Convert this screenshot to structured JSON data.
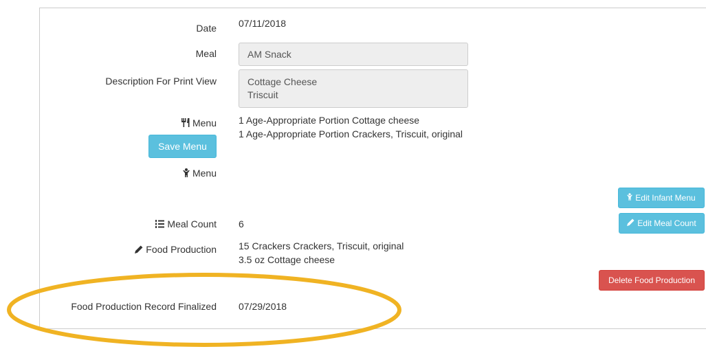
{
  "form": {
    "date_label": "Date",
    "date_value": "07/11/2018",
    "meal_label": "Meal",
    "meal_value": "AM Snack",
    "description_label": "Description For Print View",
    "description_lines": [
      "Cottage Cheese",
      "Triscuit"
    ],
    "menu_label": "Menu",
    "menu_items": [
      "1 Age-Appropriate Portion Cottage cheese",
      "1 Age-Appropriate Portion Crackers, Triscuit, original"
    ],
    "save_menu_label": "Save Menu",
    "infant_menu_label": "Menu",
    "edit_infant_menu_label": "Edit Infant Menu",
    "meal_count_label": "Meal Count",
    "meal_count_value": "6",
    "edit_meal_count_label": "Edit Meal Count",
    "food_production_label": "Food Production",
    "food_production_items": [
      "15 Crackers Crackers, Triscuit, original",
      "3.5 oz Cottage cheese"
    ],
    "delete_food_production_label": "Delete Food Production",
    "finalized_label": "Food Production Record Finalized",
    "finalized_value": "07/29/2018"
  },
  "icons": {
    "menu": "fork-knife-icon",
    "infant_menu": "child-icon",
    "meal_count": "list-ordered-icon",
    "food_production": "pencil-icon"
  },
  "colors": {
    "info_button": "#5bc0de",
    "danger_button": "#d9534f",
    "highlight_oval": "#f0b323"
  }
}
